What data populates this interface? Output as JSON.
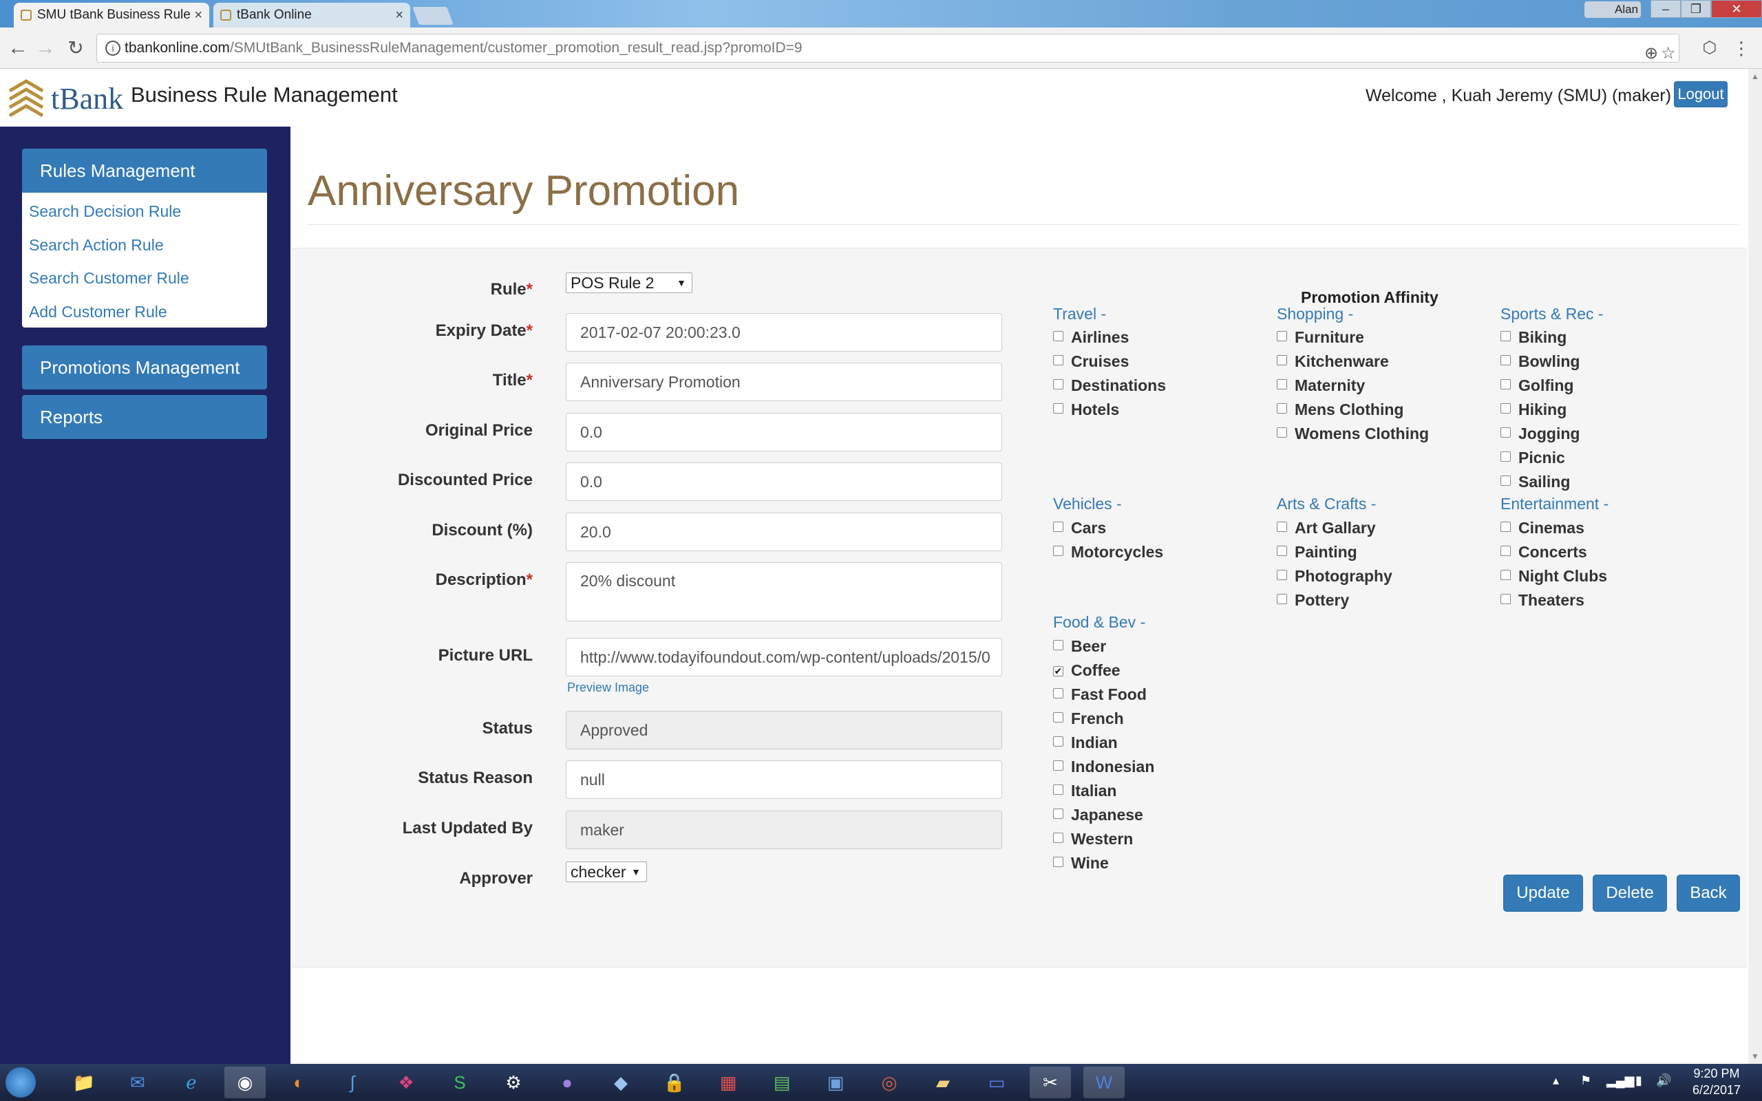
{
  "browser": {
    "tabs": [
      {
        "label": "SMU tBank Business Rule"
      },
      {
        "label": "tBank Online"
      }
    ],
    "user_badge": "Alan",
    "url_host": "tbankonline.com",
    "url_path": "/SMUtBank_BusinessRuleManagement/customer_promotion_result_read.jsp?promoID=9"
  },
  "header": {
    "brand": "tBank",
    "app_title": "Business Rule Management",
    "welcome": "Welcome , Kuah Jeremy (SMU) (maker)",
    "logout_label": "Logout"
  },
  "sidebar": {
    "rules_management": "Rules Management",
    "items": [
      {
        "label": "Search Decision Rule"
      },
      {
        "label": "Search Action Rule"
      },
      {
        "label": "Search Customer Rule"
      },
      {
        "label": "Add Customer Rule"
      }
    ],
    "promotions_management": "Promotions Management",
    "reports": "Reports"
  },
  "main": {
    "page_title": "Anniversary Promotion",
    "form": {
      "rule": {
        "label": "Rule",
        "value": "POS Rule 2"
      },
      "expiry_date": {
        "label": "Expiry Date",
        "value": "2017-02-07 20:00:23.0"
      },
      "title": {
        "label": "Title",
        "value": "Anniversary Promotion"
      },
      "original_price": {
        "label": "Original Price",
        "value": "0.0"
      },
      "discounted_price": {
        "label": "Discounted Price",
        "value": "0.0"
      },
      "discount": {
        "label": "Discount (%)",
        "value": "20.0"
      },
      "description": {
        "label": "Description",
        "value": "20% discount"
      },
      "picture_url": {
        "label": "Picture URL",
        "value": "http://www.todayifoundout.com/wp-content/uploads/2015/0"
      },
      "preview_image": "Preview Image",
      "status": {
        "label": "Status",
        "value": "Approved"
      },
      "status_reason": {
        "label": "Status Reason",
        "value": "null"
      },
      "last_updated_by": {
        "label": "Last Updated By",
        "value": "maker"
      },
      "approver": {
        "label": "Approver",
        "value": "checker"
      },
      "required_mark": "*"
    },
    "affinity": {
      "title": "Promotion Affinity",
      "categories": {
        "travel": {
          "label": "Travel -",
          "items": [
            {
              "label": "Airlines",
              "checked": false
            },
            {
              "label": "Cruises",
              "checked": false
            },
            {
              "label": "Destinations",
              "checked": false
            },
            {
              "label": "Hotels",
              "checked": false
            }
          ]
        },
        "shopping": {
          "label": "Shopping -",
          "items": [
            {
              "label": "Furniture",
              "checked": false
            },
            {
              "label": "Kitchenware",
              "checked": false
            },
            {
              "label": "Maternity",
              "checked": false
            },
            {
              "label": "Mens Clothing",
              "checked": false
            },
            {
              "label": "Womens Clothing",
              "checked": false
            }
          ]
        },
        "sports": {
          "label": "Sports & Rec -",
          "items": [
            {
              "label": "Biking",
              "checked": false
            },
            {
              "label": "Bowling",
              "checked": false
            },
            {
              "label": "Golfing",
              "checked": false
            },
            {
              "label": "Hiking",
              "checked": false
            },
            {
              "label": "Jogging",
              "checked": false
            },
            {
              "label": "Picnic",
              "checked": false
            },
            {
              "label": "Sailing",
              "checked": false
            }
          ]
        },
        "vehicles": {
          "label": "Vehicles -",
          "items": [
            {
              "label": "Cars",
              "checked": false
            },
            {
              "label": "Motorcycles",
              "checked": false
            }
          ]
        },
        "arts": {
          "label": "Arts & Crafts -",
          "items": [
            {
              "label": "Art Gallary",
              "checked": false
            },
            {
              "label": "Painting",
              "checked": false
            },
            {
              "label": "Photography",
              "checked": false
            },
            {
              "label": "Pottery",
              "checked": false
            }
          ]
        },
        "entertainment": {
          "label": "Entertainment -",
          "items": [
            {
              "label": "Cinemas",
              "checked": false
            },
            {
              "label": "Concerts",
              "checked": false
            },
            {
              "label": "Night Clubs",
              "checked": false
            },
            {
              "label": "Theaters",
              "checked": false
            }
          ]
        },
        "food": {
          "label": "Food & Bev -",
          "items": [
            {
              "label": "Beer",
              "checked": false
            },
            {
              "label": "Coffee",
              "checked": true
            },
            {
              "label": "Fast Food",
              "checked": false
            },
            {
              "label": "French",
              "checked": false
            },
            {
              "label": "Indian",
              "checked": false
            },
            {
              "label": "Indonesian",
              "checked": false
            },
            {
              "label": "Italian",
              "checked": false
            },
            {
              "label": "Japanese",
              "checked": false
            },
            {
              "label": "Western",
              "checked": false
            },
            {
              "label": "Wine",
              "checked": false
            }
          ]
        }
      }
    },
    "buttons": {
      "update": "Update",
      "delete": "Delete",
      "back": "Back"
    }
  },
  "taskbar": {
    "time": "9:20 PM",
    "date": "6/2/2017"
  },
  "colors": {
    "sidebar_bg": "#1d2261",
    "accent": "#337ab7",
    "title_color": "#8b6f47",
    "required": "#c9302c"
  }
}
